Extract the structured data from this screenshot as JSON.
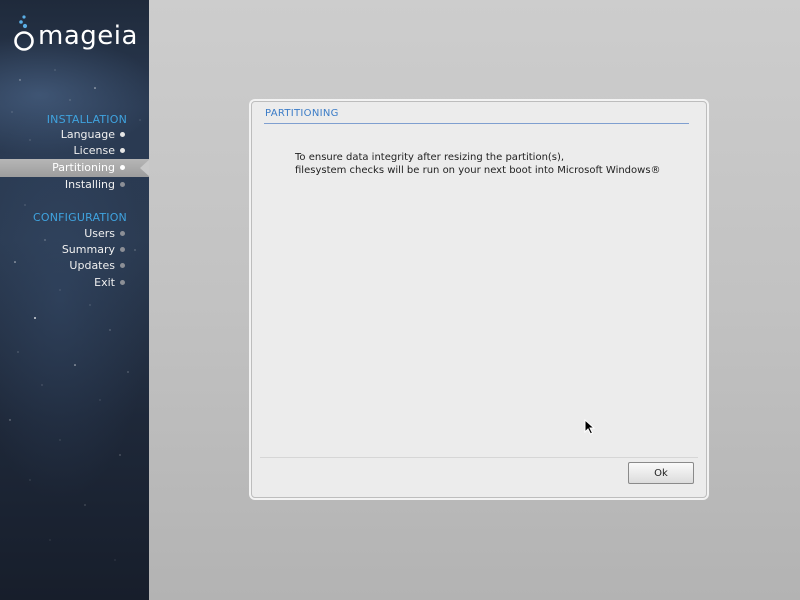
{
  "branding": {
    "logo_text": "mageia"
  },
  "sidebar": {
    "sections": [
      {
        "title": "INSTALLATION",
        "items": [
          {
            "label": "Language",
            "state": "done"
          },
          {
            "label": "License",
            "state": "done"
          },
          {
            "label": "Partitioning",
            "state": "active"
          },
          {
            "label": "Installing",
            "state": "pending"
          }
        ]
      },
      {
        "title": "CONFIGURATION",
        "items": [
          {
            "label": "Users",
            "state": "pending"
          },
          {
            "label": "Summary",
            "state": "pending"
          },
          {
            "label": "Updates",
            "state": "pending"
          },
          {
            "label": "Exit",
            "state": "pending"
          }
        ]
      }
    ]
  },
  "dialog": {
    "title": "PARTITIONING",
    "message_lines": [
      "To ensure data integrity after resizing the partition(s),",
      "filesystem checks will be run on your next boot into Microsoft Windows®"
    ],
    "ok_label": "Ok"
  },
  "colors": {
    "accent": "#3fa3df",
    "dialog_title": "#3b7cc7",
    "sidebar_dark": "#1e2839",
    "desktop_bg": "#c2c2c2"
  }
}
